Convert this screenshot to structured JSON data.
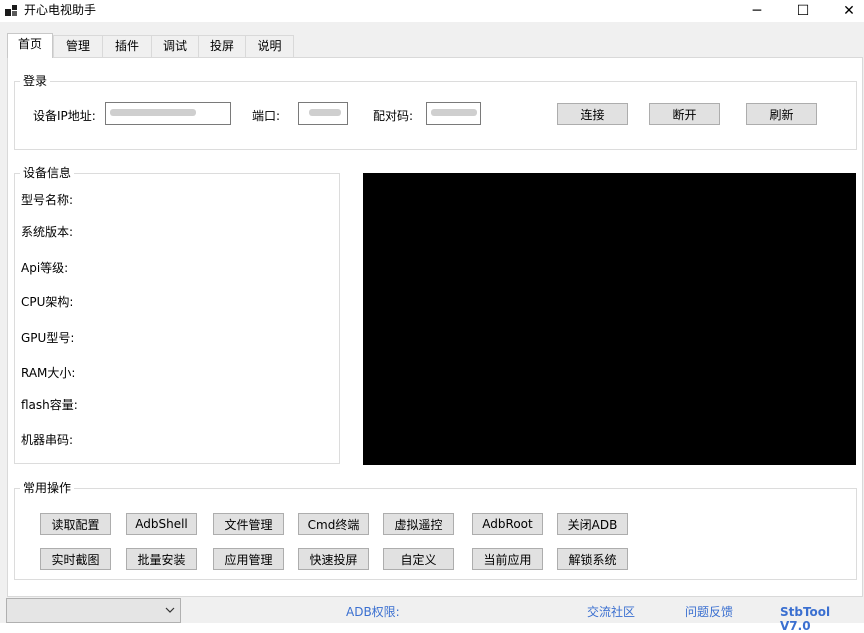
{
  "window": {
    "title": "开心电视助手",
    "minimize_glyph": "─",
    "maximize_glyph": "☐",
    "close_glyph": "✕"
  },
  "tabs": [
    {
      "label": "首页",
      "active": true
    },
    {
      "label": "管理"
    },
    {
      "label": "插件"
    },
    {
      "label": "调试"
    },
    {
      "label": "投屏"
    },
    {
      "label": "说明"
    }
  ],
  "login": {
    "group_title": "登录",
    "ip_label": "设备IP地址:",
    "ip_value": "",
    "port_label": "端口:",
    "port_value": "",
    "pair_label": "配对码:",
    "pair_value": "",
    "connect": "连接",
    "disconnect": "断开",
    "refresh": "刷新"
  },
  "device_info": {
    "group_title": "设备信息",
    "fields": [
      "型号名称:",
      "系统版本:",
      "Api等级:",
      "CPU架构:",
      "GPU型号:",
      "RAM大小:",
      "flash容量:",
      "机器串码:"
    ]
  },
  "operations": {
    "group_title": "常用操作",
    "row1": [
      "读取配置",
      "AdbShell",
      "文件管理",
      "Cmd终端",
      "虚拟遥控",
      "AdbRoot",
      "关闭ADB"
    ],
    "row2": [
      "实时截图",
      "批量安装",
      "应用管理",
      "快速投屏",
      "自定义",
      "当前应用",
      "解锁系统"
    ]
  },
  "status": {
    "combo_value": "",
    "adb_permission": "ADB权限:",
    "community": "交流社区",
    "feedback": "问题反馈",
    "version": "StbTool V7.0"
  },
  "colors": {
    "status_text": "#3a6fd0",
    "screen_bg": "#000000",
    "button_bg": "#e1e1e1"
  },
  "icons": {
    "app": "app-icon",
    "combo_arrow": "chevron-down-icon"
  }
}
